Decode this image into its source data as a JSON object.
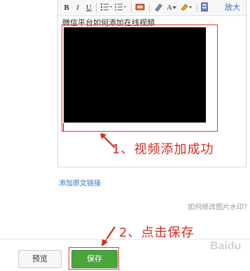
{
  "toolbar": {
    "bold": "B",
    "italic": "I",
    "underline": "U",
    "ordered_list_icon": "ordered-list-icon",
    "unordered_list_icon": "unordered-list-icon",
    "font_color": "A",
    "zoom_label": "放大"
  },
  "editor": {
    "title_text": "微信平台如何添加在线视频"
  },
  "annotations": {
    "step1": "1、视频添加成功",
    "step2": "2、点击保存"
  },
  "links": {
    "source_link": "添加原文链接",
    "help_link": "如何修改图片水印？"
  },
  "buttons": {
    "preview": "预览",
    "save": "保存"
  },
  "colors": {
    "annotation_red": "#d92b20",
    "save_green": "#4aa53c",
    "link_blue": "#2e72c8"
  },
  "watermark": {
    "text": "Baidu"
  }
}
